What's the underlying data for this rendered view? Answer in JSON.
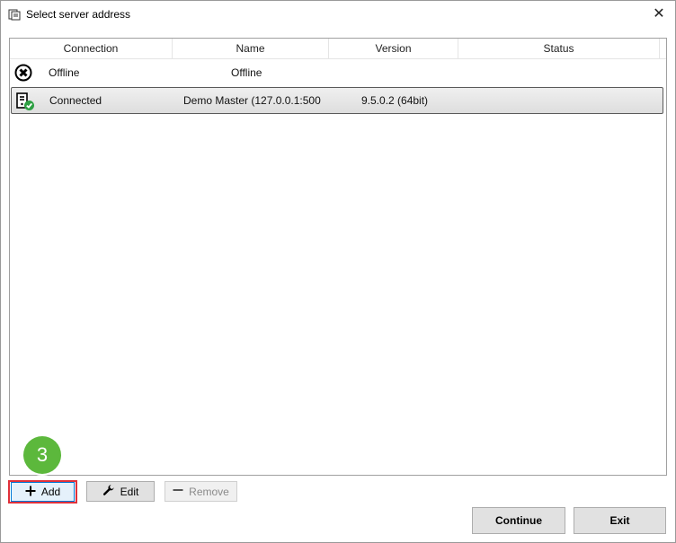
{
  "window": {
    "title": "Select server address",
    "close_glyph": "✕"
  },
  "table": {
    "columns": [
      "Connection",
      "Name",
      "Version",
      "Status"
    ],
    "rows": [
      {
        "icon": "offline-x-icon",
        "connection": "Offline",
        "name": "Offline",
        "version": "",
        "status": "",
        "selected": false
      },
      {
        "icon": "server-connected-icon",
        "connection": "Connected",
        "name": "Demo Master (127.0.0.1:500",
        "version": "9.5.0.2 (64bit)",
        "status": "",
        "selected": true
      }
    ]
  },
  "toolbar": {
    "add_label": "Add",
    "edit_label": "Edit",
    "remove_label": "Remove"
  },
  "footer": {
    "continue_label": "Continue",
    "exit_label": "Exit"
  },
  "annotation": {
    "step_number": "3"
  },
  "colors": {
    "highlight": "#e0303a",
    "badge": "#5cb83c",
    "connected_check": "#2ea043"
  }
}
